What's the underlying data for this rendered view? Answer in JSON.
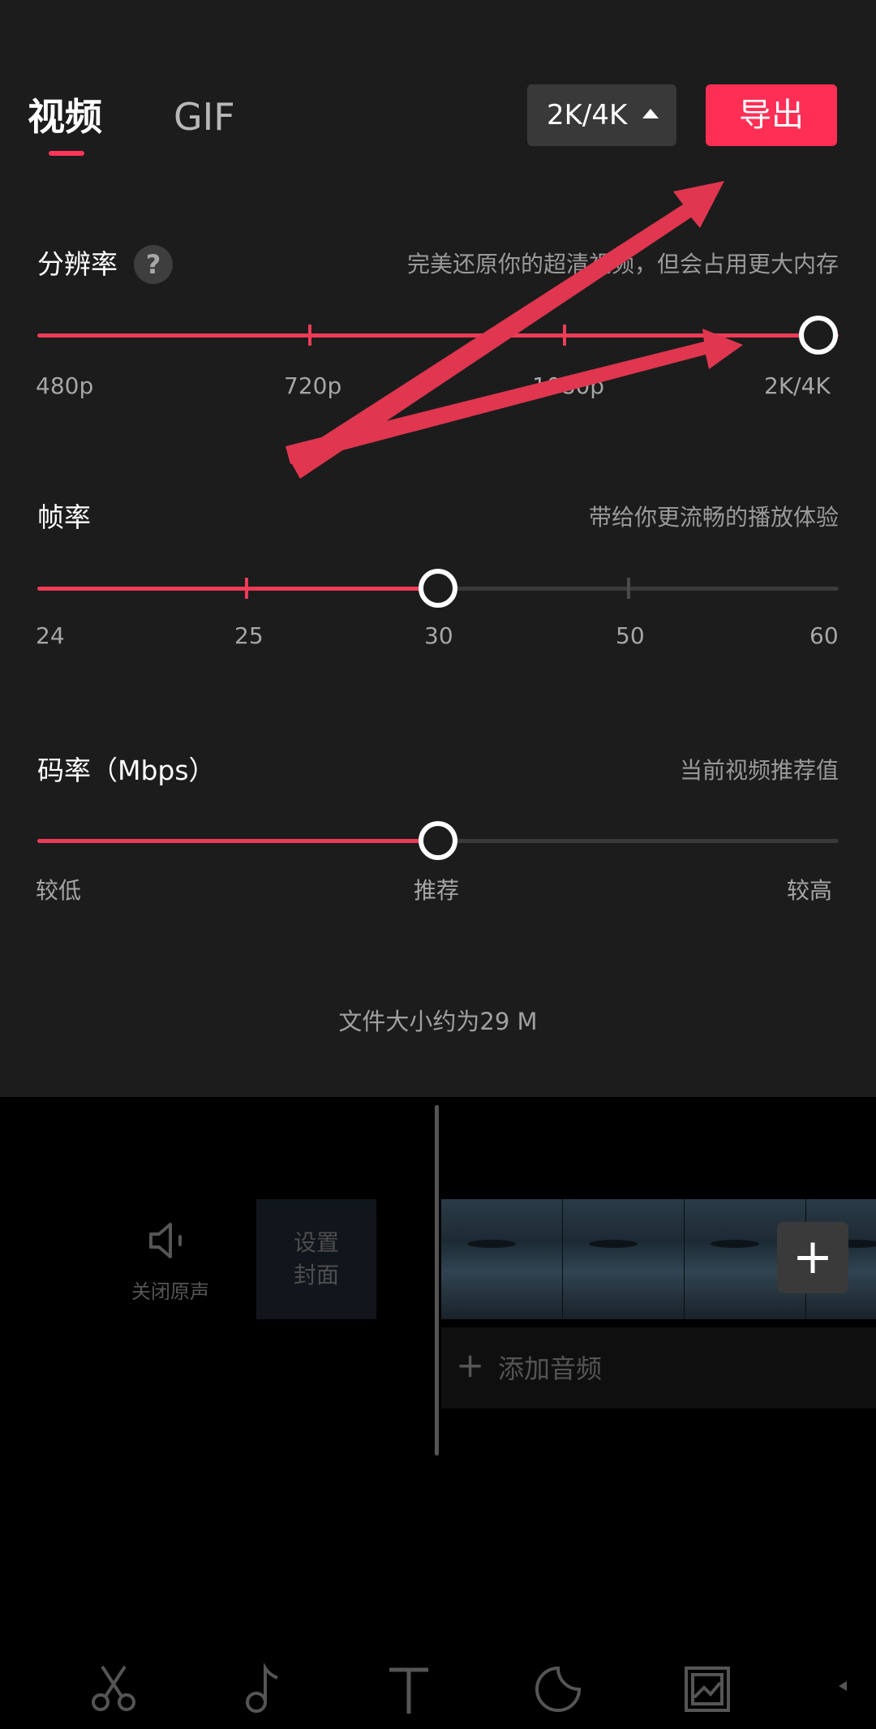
{
  "header": {
    "tabs": [
      {
        "label": "视频",
        "active": true
      },
      {
        "label": "GIF",
        "active": false
      }
    ],
    "resolution_button": "2K/4K",
    "export_button": "导出"
  },
  "resolution": {
    "title": "分辨率",
    "help_icon": "?",
    "hint": "完美还原你的超清视频，但会占用更大内存",
    "options": [
      "480p",
      "720p",
      "1080p",
      "2K/4K"
    ],
    "selected": "2K/4K",
    "value_fraction": 1.0
  },
  "frame_rate": {
    "title": "帧率",
    "hint": "带给你更流畅的播放体验",
    "options": [
      "24",
      "25",
      "30",
      "50",
      "60"
    ],
    "selected": "30",
    "value_fraction": 0.5
  },
  "bitrate": {
    "title": "码率（Mbps）",
    "hint": "当前视频推荐值",
    "options": [
      "较低",
      "推荐",
      "较高"
    ],
    "selected": "推荐",
    "value_fraction": 0.5
  },
  "file_size": "文件大小约为29 M",
  "editor": {
    "mute_label": "关闭原声",
    "cover_label_line1": "设置",
    "cover_label_line2": "封面",
    "add_clip": "+",
    "add_audio_plus": "+",
    "add_audio": "添加音频"
  },
  "toolbar_icons": [
    "scissors-icon",
    "music-note-icon",
    "text-icon",
    "sticker-icon",
    "image-icon",
    "more-icon"
  ],
  "colors": {
    "accent": "#ff2e55",
    "slider_active": "#ef3b57",
    "panel_bg": "#1c1c1c",
    "annotation_arrow": "#e0364f"
  }
}
